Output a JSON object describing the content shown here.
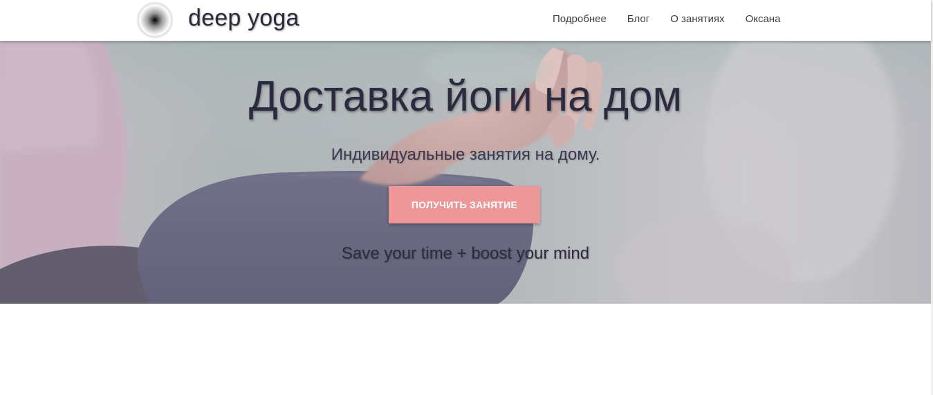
{
  "header": {
    "brand": "deep yoga",
    "nav": [
      {
        "label": "Подробнее"
      },
      {
        "label": "Блог"
      },
      {
        "label": "О занятиях"
      },
      {
        "label": "Оксана"
      }
    ]
  },
  "hero": {
    "title": "Доставка йоги на дом",
    "subtitle": "Индивидуальные занятия на дому.",
    "cta_label": "ПОЛУЧИТЬ ЗАНЯТИЕ",
    "tagline": "Save your time + boost your mind",
    "background_image": "meditation-hand-mudra-photo",
    "colors": {
      "cta": "#ee9799",
      "text": "#2c2a3e"
    }
  }
}
